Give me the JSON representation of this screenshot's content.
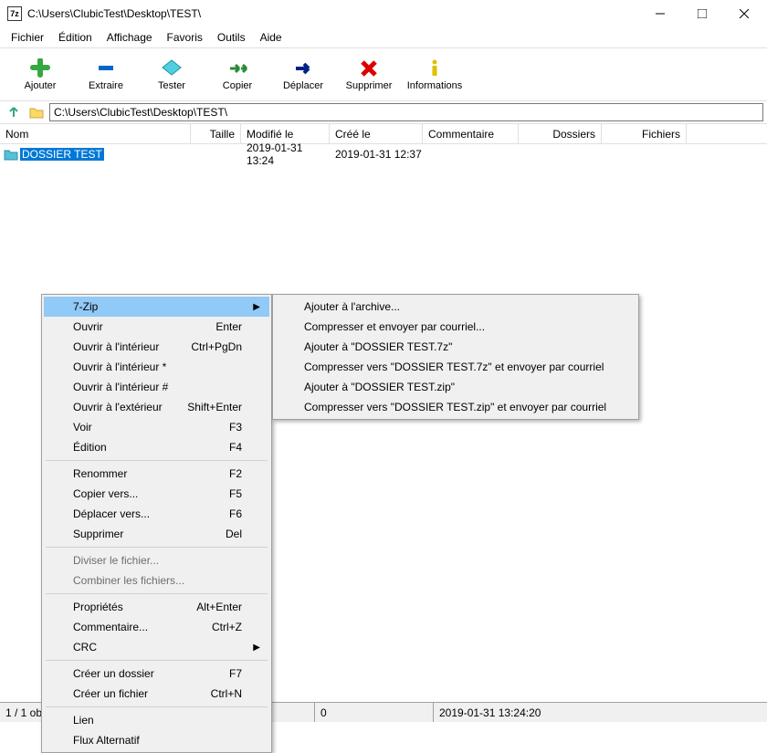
{
  "window": {
    "title": "C:\\Users\\ClubicTest\\Desktop\\TEST\\",
    "icon_text": "7z"
  },
  "menubar": [
    "Fichier",
    "Édition",
    "Affichage",
    "Favoris",
    "Outils",
    "Aide"
  ],
  "toolbar": {
    "add": "Ajouter",
    "extract": "Extraire",
    "test": "Tester",
    "copy": "Copier",
    "move": "Déplacer",
    "delete": "Supprimer",
    "info": "Informations"
  },
  "path": "C:\\Users\\ClubicTest\\Desktop\\TEST\\",
  "columns": {
    "nom": "Nom",
    "taille": "Taille",
    "modifie": "Modifié le",
    "cree": "Créé le",
    "commentaire": "Commentaire",
    "dossiers": "Dossiers",
    "fichiers": "Fichiers"
  },
  "file_row": {
    "name": "DOSSIER TEST",
    "modified": "2019-01-31 13:24",
    "created": "2019-01-31 12:37"
  },
  "context_menu": {
    "zip": "7-Zip",
    "open": "Ouvrir",
    "open_shortcut": "Enter",
    "open_inside": "Ouvrir à l'intérieur",
    "open_inside_shortcut": "Ctrl+PgDn",
    "open_inside_star": "Ouvrir à l'intérieur *",
    "open_inside_hash": "Ouvrir à l'intérieur #",
    "open_outside": "Ouvrir à l'extérieur",
    "open_outside_shortcut": "Shift+Enter",
    "view": "Voir",
    "view_shortcut": "F3",
    "edit": "Édition",
    "edit_shortcut": "F4",
    "rename": "Renommer",
    "rename_shortcut": "F2",
    "copy_to": "Copier vers...",
    "copy_to_shortcut": "F5",
    "move_to": "Déplacer vers...",
    "move_to_shortcut": "F6",
    "delete": "Supprimer",
    "delete_shortcut": "Del",
    "split": "Diviser le fichier...",
    "combine": "Combiner les fichiers...",
    "properties": "Propriétés",
    "properties_shortcut": "Alt+Enter",
    "comment": "Commentaire...",
    "comment_shortcut": "Ctrl+Z",
    "crc": "CRC",
    "create_folder": "Créer un dossier",
    "create_folder_shortcut": "F7",
    "create_file": "Créer un fichier",
    "create_file_shortcut": "Ctrl+N",
    "link": "Lien",
    "alt_stream": "Flux Alternatif"
  },
  "submenu": {
    "add_archive": "Ajouter à l'archive...",
    "compress_mail": "Compresser et envoyer par courriel...",
    "add_7z": "Ajouter à \"DOSSIER TEST.7z\"",
    "compress_7z_mail": "Compresser vers \"DOSSIER TEST.7z\" et envoyer par courriel",
    "add_zip": "Ajouter à \"DOSSIER TEST.zip\"",
    "compress_zip_mail": "Compresser vers \"DOSSIER TEST.zip\" et envoyer par courriel"
  },
  "statusbar": {
    "selection": "1 / 1 objet(s) sélectionné(s)",
    "val1": "0",
    "val2": "0",
    "date": "2019-01-31 13:24:20"
  }
}
